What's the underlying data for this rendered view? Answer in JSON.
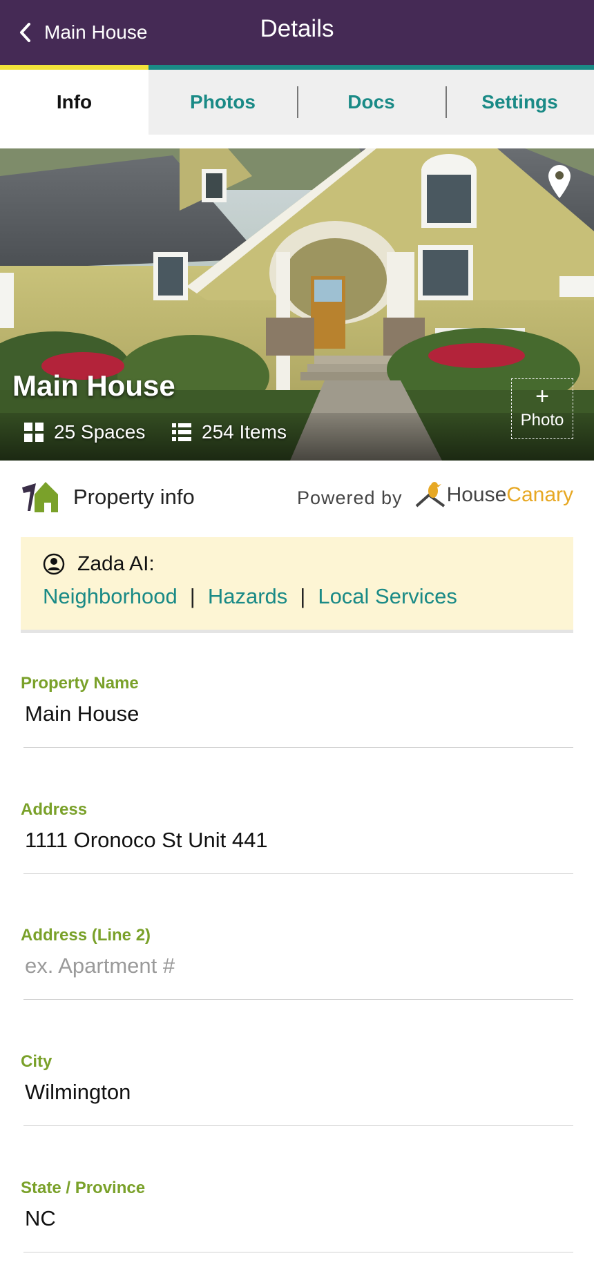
{
  "header": {
    "back_label": "Main House",
    "title": "Details",
    "icons": {
      "back": "chevron-left-icon"
    }
  },
  "tabs": [
    {
      "label": "Info",
      "active": true
    },
    {
      "label": "Photos",
      "active": false
    },
    {
      "label": "Docs",
      "active": false
    },
    {
      "label": "Settings",
      "active": false
    }
  ],
  "hero": {
    "title": "Main House",
    "spaces": "25 Spaces",
    "items": "254 Items",
    "add_photo_label": "Photo",
    "add_photo_plus": "+",
    "icons": {
      "location": "map-pin-icon",
      "spaces": "grid-icon",
      "items": "list-icon",
      "add": "plus-icon"
    }
  },
  "property_info": {
    "label": "Property info",
    "powered_by": "Powered by",
    "brand_house": "House",
    "brand_canary": "Canary"
  },
  "zada": {
    "title": "Zada AI:",
    "links": [
      "Neighborhood",
      "Hazards",
      "Local Services"
    ],
    "separator": "|"
  },
  "form": {
    "property_name": {
      "label": "Property Name",
      "value": "Main House",
      "placeholder": ""
    },
    "address": {
      "label": "Address",
      "value": "1111 Oronoco St Unit 441",
      "placeholder": ""
    },
    "address2": {
      "label": "Address (Line 2)",
      "value": "",
      "placeholder": "ex. Apartment #"
    },
    "city": {
      "label": "City",
      "value": "Wilmington",
      "placeholder": ""
    },
    "state": {
      "label": "State / Province",
      "value": "NC",
      "placeholder": ""
    }
  },
  "colors": {
    "header_bg": "#452a55",
    "accent_yellow": "#f2e23a",
    "accent_teal": "#1a8a86",
    "label_green": "#7aa12a",
    "zada_bg": "#fdf5d4",
    "canary_orange": "#e7a824"
  }
}
